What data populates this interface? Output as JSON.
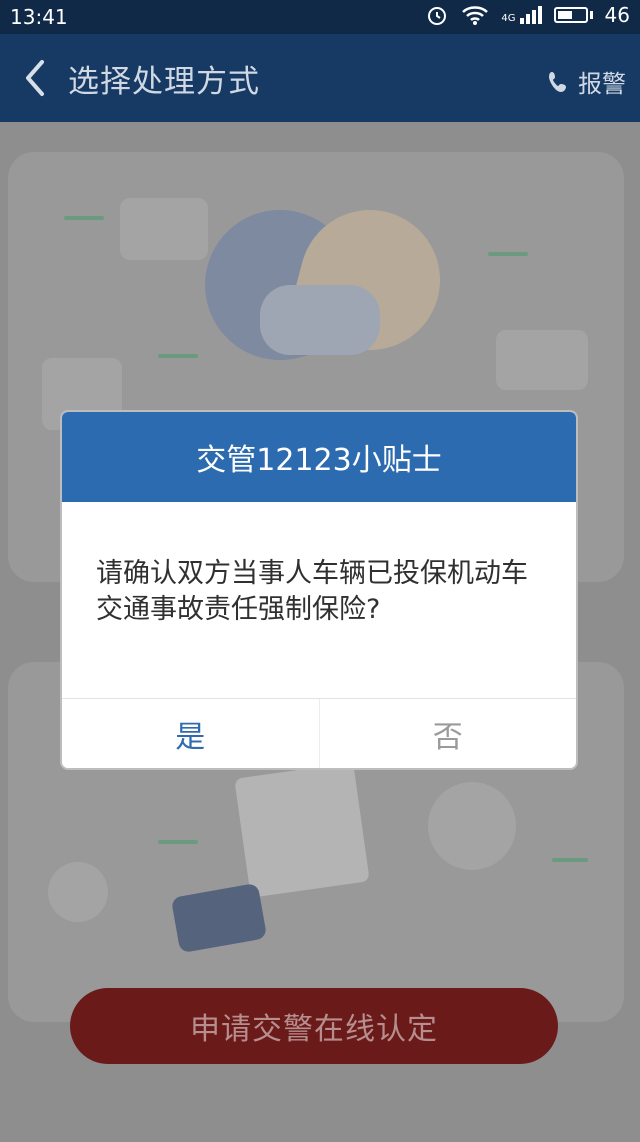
{
  "status_bar": {
    "time": "13:41",
    "battery": "46",
    "signal_label": "4G"
  },
  "navbar": {
    "title": "选择处理方式",
    "alarm_label": "报警"
  },
  "dialog": {
    "title": "交管12123小贴士",
    "message": "请确认双方当事人车辆已投保机动车交通事故责任强制保险?",
    "yes_label": "是",
    "no_label": "否"
  },
  "bottom_button": {
    "label": "申请交警在线认定"
  }
}
